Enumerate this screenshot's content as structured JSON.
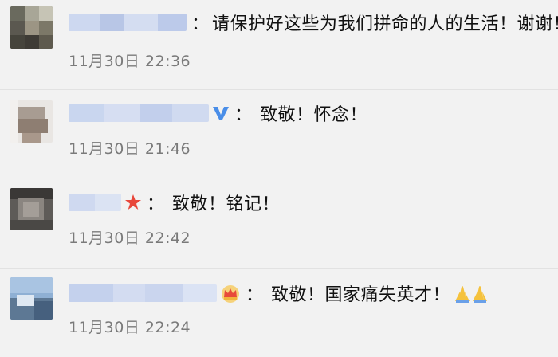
{
  "comments": [
    {
      "text": "请保护好这些为我们拼命的人的生活！谢谢！",
      "time": "11月30日 22:36",
      "badge": null
    },
    {
      "text": "致敬！怀念！",
      "time": "11月30日 21:46",
      "badge": "verified-v-icon"
    },
    {
      "text": "致敬！铭记！",
      "time": "11月30日 22:42",
      "badge": "red-star-icon"
    },
    {
      "text": "致敬！国家痛失英才！",
      "time": "11月30日 22:24",
      "badge": "crown-icon",
      "trailing_emoji": "folded-hands-icon"
    }
  ],
  "separator": "：",
  "colors": {
    "background": "#f2f2f2",
    "text": "#111111",
    "time": "#7a7a7a",
    "verified": "#4a8ee8",
    "star": "#e8463a",
    "crown": "#f2b33c"
  }
}
